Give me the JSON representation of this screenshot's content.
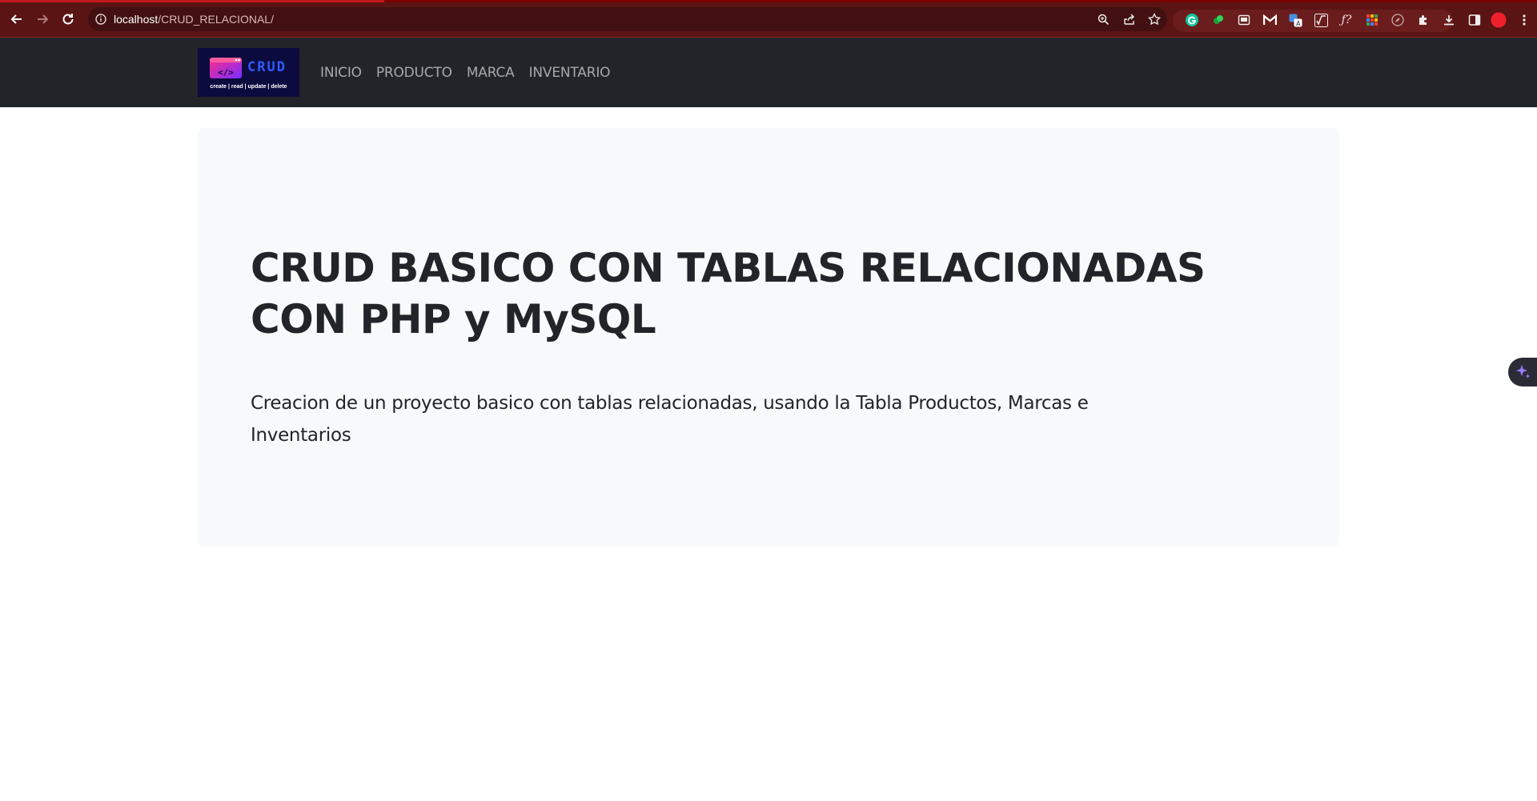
{
  "browser": {
    "url_host": "localhost",
    "url_path": "/CRUD_RELACIONAL/",
    "accent": "#5a1414",
    "icons": [
      "back-arrow-icon",
      "forward-arrow-icon",
      "reload-icon",
      "info-icon",
      "zoom-icon",
      "share-icon",
      "star-icon",
      "grammarly-icon",
      "extension-green-icon",
      "screen-icon",
      "gmail-icon",
      "translate-icon",
      "sqrt-icon",
      "formula-icon",
      "grid-icon",
      "compass-icon",
      "puzzle-icon",
      "download-icon",
      "sidebar-icon",
      "profile-icon",
      "menu-dots-icon"
    ]
  },
  "navbar": {
    "logo": {
      "word": "CRUD",
      "subtitle": "create | read | update | delete"
    },
    "items": [
      {
        "label": "INICIO"
      },
      {
        "label": "PRODUCTO"
      },
      {
        "label": "MARCA"
      },
      {
        "label": "INVENTARIO"
      }
    ],
    "background": "#212529"
  },
  "hero": {
    "title": "CRUD BASICO CON TABLAS RELACIONADAS CON PHP y MySQL",
    "lead": "Creacion de un proyecto basico con tablas relacionadas, usando la Tabla Productos, Marcas e Inventarios",
    "background": "#f8f9fa"
  },
  "side_widget": {
    "icon": "sparkle-icon",
    "color": "#8a6bff"
  }
}
